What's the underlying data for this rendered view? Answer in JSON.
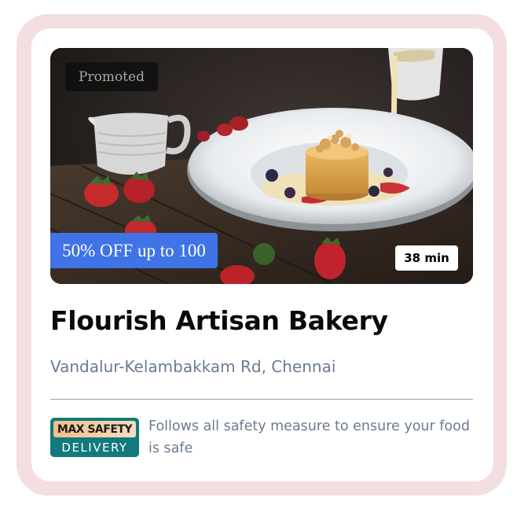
{
  "restaurant": {
    "name": "Flourish Artisan Bakery",
    "address": "Vandalur-Kelambakkam Rd, Chennai"
  },
  "photo": {
    "promoted_label": "Promoted",
    "offer_label": "50% OFF up to 100",
    "delivery_time": "38 min"
  },
  "safety": {
    "badge_top": "MAX SAFETY",
    "badge_bottom": "DELIVERY",
    "text": "Follows all safety measure to ensure your food is safe",
    "badge_icon": "max-safety-delivery-icon"
  },
  "colors": {
    "outer_border": "#f3dfe0",
    "offer_bg": "#3f73e6",
    "address_text": "#6b7b90",
    "badge_bg": "#12797c"
  }
}
